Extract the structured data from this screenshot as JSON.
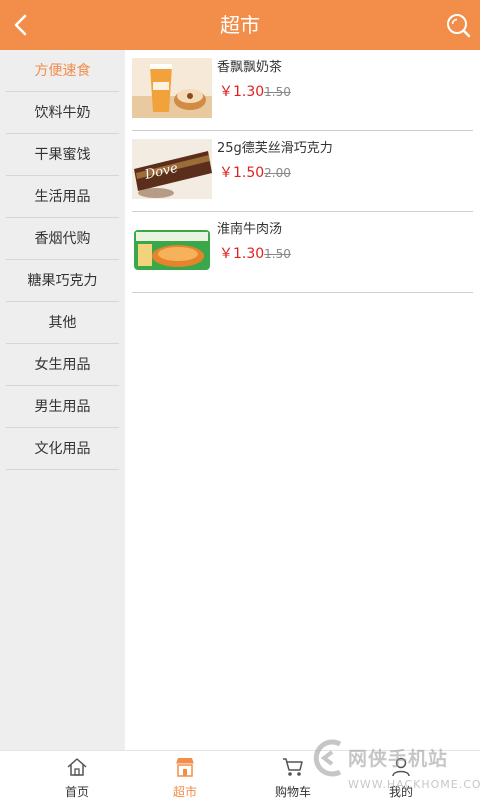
{
  "header": {
    "title": "超市",
    "back_icon": "chevron-left-icon",
    "search_icon": "search-icon"
  },
  "colors": {
    "accent": "#f28d4a",
    "price": "#e02020",
    "sidebar_bg": "#eeeeee"
  },
  "sidebar": {
    "items": [
      {
        "label": "方便速食",
        "active": true
      },
      {
        "label": "饮料牛奶"
      },
      {
        "label": "干果蜜饯"
      },
      {
        "label": "生活用品"
      },
      {
        "label": "香烟代购"
      },
      {
        "label": "糖果巧克力"
      },
      {
        "label": "其他"
      },
      {
        "label": "女生用品"
      },
      {
        "label": "男生用品"
      },
      {
        "label": "文化用品"
      }
    ]
  },
  "products": [
    {
      "name": "香飘飘奶茶",
      "price": "￥1.30",
      "old_price": "1.50",
      "image": "milk-tea-cup"
    },
    {
      "name": "25g德芙丝滑巧克力",
      "price": "￥1.50",
      "old_price": "2.00",
      "image": "dove-chocolate"
    },
    {
      "name": "淮南牛肉汤",
      "price": "￥1.30",
      "old_price": "1.50",
      "image": "beef-soup-pack"
    }
  ],
  "tabbar": {
    "items": [
      {
        "label": "首页",
        "icon": "home-icon"
      },
      {
        "label": "超市",
        "icon": "store-icon",
        "active": true
      },
      {
        "label": "购物车",
        "icon": "cart-icon"
      },
      {
        "label": "我的",
        "icon": "user-icon"
      }
    ]
  },
  "watermark": {
    "text": "网侠手机站",
    "url": "WWW.HACKHOME.COM"
  }
}
